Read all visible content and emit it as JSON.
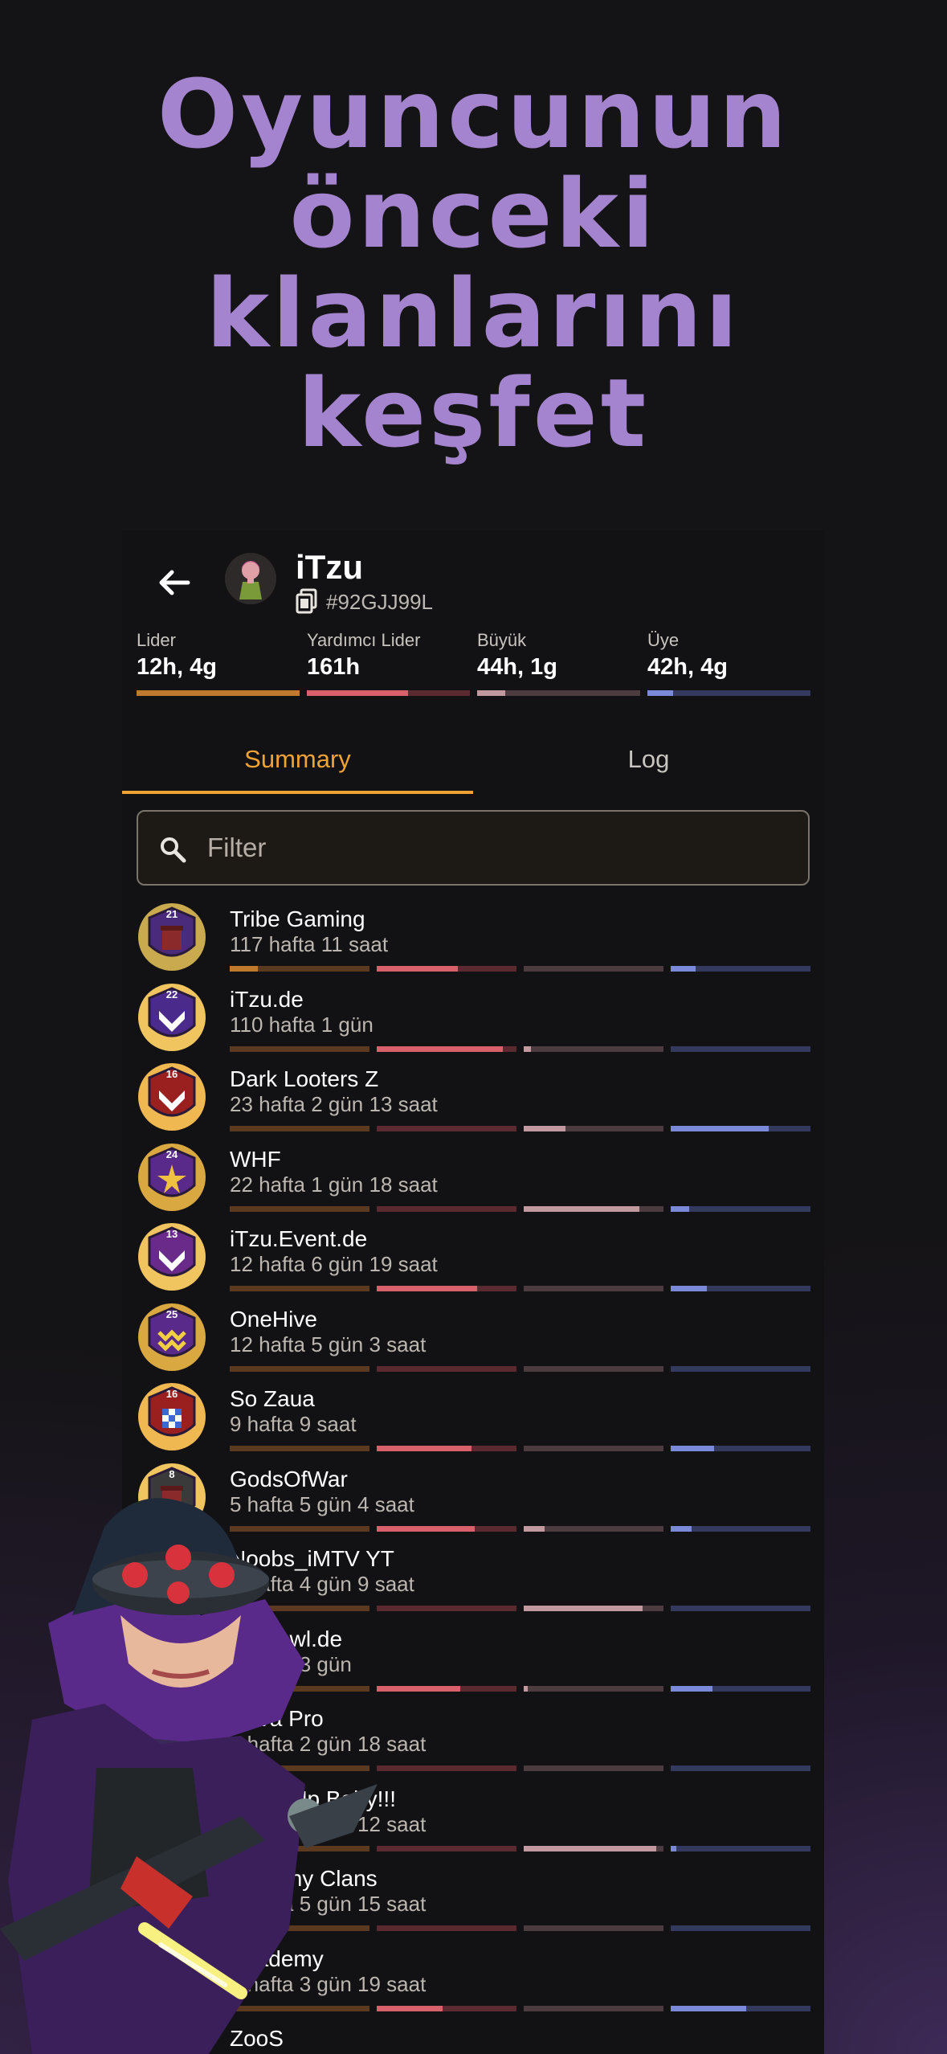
{
  "headline": [
    "Oyuncunun",
    "önceki",
    "klanlarını",
    "keşfet"
  ],
  "player": {
    "name": "iTzu",
    "tag": "#92GJJ99L"
  },
  "colors": {
    "accent": "#f0a335",
    "leader": [
      "#c07a2e",
      "#5b3a1f"
    ],
    "coleader": [
      "#d9616b",
      "#5b2a30"
    ],
    "elder": [
      "#c2999f",
      "#4c3c3f"
    ],
    "member": [
      "#7a8ad8",
      "#343a5e"
    ]
  },
  "roles": [
    {
      "label": "Lider",
      "value": "12h, 4g",
      "share": 1.0
    },
    {
      "label": "Yardımcı Lider",
      "value": "161h",
      "share": 0.62
    },
    {
      "label": "Büyük",
      "value": "44h, 1g",
      "share": 0.17
    },
    {
      "label": "Üye",
      "value": "42h, 4g",
      "share": 0.16
    }
  ],
  "tabs": {
    "summary": "Summary",
    "log": "Log"
  },
  "filter": {
    "placeholder": "Filter"
  },
  "clans": [
    {
      "name": "Tribe Gaming",
      "duration": "117 hafta 11 saat",
      "level": "21",
      "badge": "tower",
      "ring": "#c9aa4e",
      "inner": "#4a2a7a",
      "shares": [
        0.2,
        0.58,
        0.0,
        0.18
      ]
    },
    {
      "name": "iTzu.de",
      "duration": "110 hafta 1 gün",
      "level": "22",
      "badge": "chevron",
      "ring": "#f0c45e",
      "inner": "#4a2a8a",
      "shares": [
        0.0,
        0.9,
        0.05,
        0.0
      ]
    },
    {
      "name": "Dark Looters Z",
      "duration": "23 hafta 2 gün 13 saat",
      "level": "16",
      "badge": "chevron",
      "ring": "#f0b850",
      "inner": "#9a2020",
      "shares": [
        0.0,
        0.0,
        0.3,
        0.7
      ]
    },
    {
      "name": "WHF",
      "duration": "22 hafta 1 gün 18 saat",
      "level": "24",
      "badge": "star",
      "ring": "#d9a840",
      "inner": "#5a2a8a",
      "shares": [
        0.0,
        0.0,
        0.83,
        0.13
      ]
    },
    {
      "name": "iTzu.Event.de",
      "duration": "12 hafta 6 gün 19 saat",
      "level": "13",
      "badge": "chevron",
      "ring": "#f0c45e",
      "inner": "#6a2a8a",
      "shares": [
        0.0,
        0.72,
        0.0,
        0.26
      ]
    },
    {
      "name": "OneHive",
      "duration": "12 hafta 5 gün 3 saat",
      "level": "25",
      "badge": "waves",
      "ring": "#d9a840",
      "inner": "#5a2a8a",
      "shares": [
        0.0,
        0.0,
        0.0,
        0.0
      ]
    },
    {
      "name": "So Zaua",
      "duration": "9 hafta 9 saat",
      "level": "16",
      "badge": "checker",
      "ring": "#f0b850",
      "inner": "#9a2020",
      "shares": [
        0.0,
        0.68,
        0.0,
        0.31
      ]
    },
    {
      "name": "GodsOfWar",
      "duration": "5 hafta 5 gün 4 saat",
      "level": "8",
      "badge": "tower",
      "ring": "#f0c45e",
      "inner": "#3a3a3a",
      "shares": [
        0.0,
        0.7,
        0.15,
        0.15
      ]
    },
    {
      "name": "Noobs_iMTV YT",
      "duration": "2 hafta 4 gün 9 saat",
      "level": "",
      "badge": "none",
      "ring": "#d9a840",
      "inner": "#3a2a5a",
      "shares": [
        0.0,
        0.0,
        0.85,
        0.0
      ]
    },
    {
      "name": "iTzu.cwl.de",
      "duration": "1 hafta 3 gün",
      "level": "",
      "badge": "none",
      "ring": "#d9a840",
      "inner": "#3a2a5a",
      "shares": [
        0.0,
        0.6,
        0.03,
        0.3
      ]
    },
    {
      "name": "Nova Pro",
      "duration": "1 hafta 2 gün 18 saat",
      "level": "",
      "badge": "none",
      "ring": "#d9a840",
      "inner": "#3a2a5a",
      "shares": [
        0.0,
        0.0,
        0.0,
        0.0
      ]
    },
    {
      "name": "Jump Up Baby!!!",
      "duration": "1 hafta 6 gün 12 saat",
      "level": "",
      "badge": "none",
      "ring": "#d9a840",
      "inner": "#3a2a5a",
      "shares": [
        0.0,
        0.0,
        0.95,
        0.04
      ]
    },
    {
      "name": "Join any Clans",
      "duration": "1 hafta 5 gün 15 saat",
      "level": "",
      "badge": "none",
      "ring": "#d9a840",
      "inner": "#3a2a5a",
      "shares": [
        0.0,
        0.0,
        0.0,
        0.0
      ]
    },
    {
      "name": "Academy",
      "duration": "1 hafta 3 gün 19 saat",
      "level": "",
      "badge": "none",
      "ring": "#d9a840",
      "inner": "#3a2a5a",
      "shares": [
        0.0,
        0.47,
        0.0,
        0.54
      ]
    },
    {
      "name": "ZooS",
      "duration": "",
      "level": "",
      "badge": "none",
      "ring": "#d9a840",
      "inner": "#3a2a5a",
      "shares": [
        0.0,
        0.0,
        0.0,
        0.0
      ]
    }
  ]
}
